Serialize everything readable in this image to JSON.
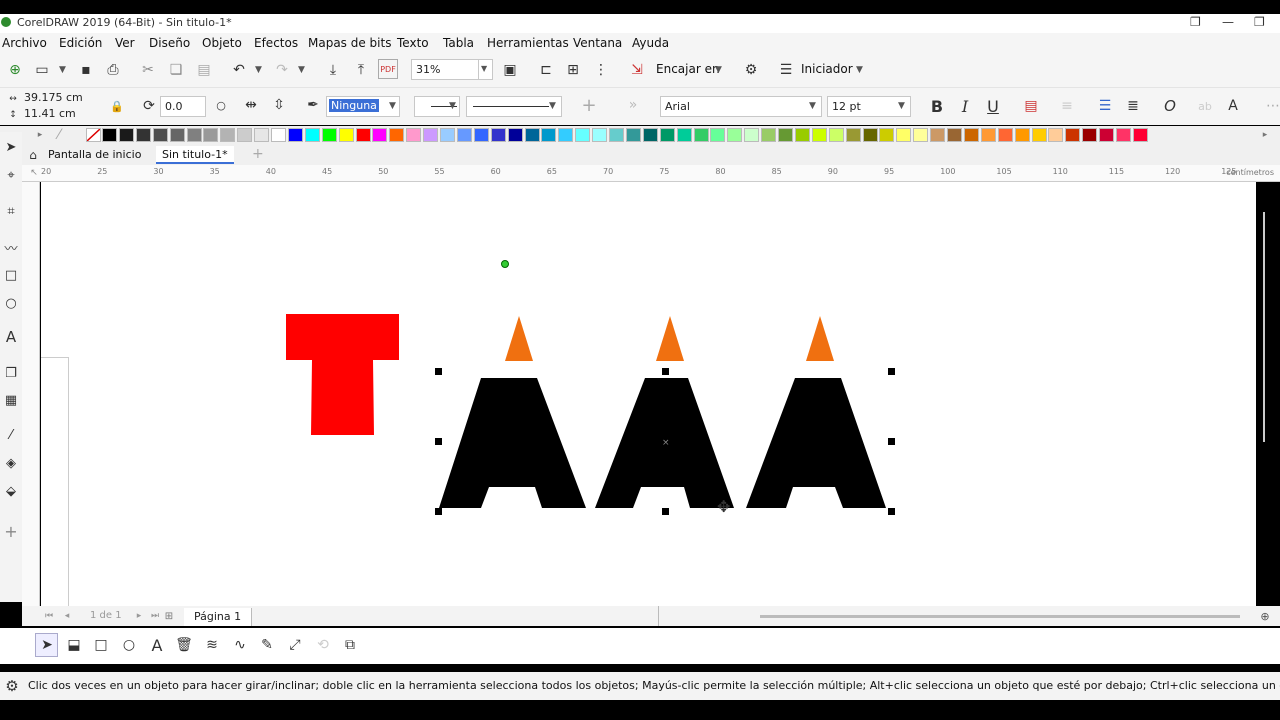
{
  "window": {
    "title": "CorelDRAW 2019 (64-Bit) - Sin titulo-1*",
    "restore_symbol": "❐",
    "minimize_symbol": "—"
  },
  "menu": [
    "Archivo",
    "Edición",
    "Ver",
    "Diseño",
    "Objeto",
    "Efectos",
    "Mapas de bits",
    "Texto",
    "Tabla",
    "Herramientas",
    "Ventana",
    "Ayuda"
  ],
  "toolbar": {
    "zoom": "31%",
    "snap_label": "Encajar en",
    "launcher_label": "Iniciador",
    "pdf_label": "PDF"
  },
  "property_bar": {
    "width": "39.175 cm",
    "height": "11.41 cm",
    "rotation": "0.0",
    "outline_fill": "Ninguna",
    "font_name": "Arial",
    "font_size": "12 pt",
    "bold": "B",
    "italic": "I",
    "underline": "U"
  },
  "palette_colors": [
    "#000000",
    "#1a1a1a",
    "#333333",
    "#4d4d4d",
    "#666666",
    "#808080",
    "#999999",
    "#b3b3b3",
    "#cccccc",
    "#e6e6e6",
    "#ffffff",
    "#0000ff",
    "#00ffff",
    "#00ff00",
    "#ffff00",
    "#ff0000",
    "#ff00ff",
    "#ff6600",
    "#ff99cc",
    "#cc99ff",
    "#99ccff",
    "#6699ff",
    "#3366ff",
    "#3333cc",
    "#000099",
    "#006699",
    "#0099cc",
    "#33ccff",
    "#66ffff",
    "#99ffff",
    "#66cccc",
    "#339999",
    "#006666",
    "#009966",
    "#00cc99",
    "#33cc66",
    "#66ff99",
    "#99ff99",
    "#ccffcc",
    "#99cc66",
    "#669933",
    "#99cc00",
    "#ccff00",
    "#ccff66",
    "#999933",
    "#666600",
    "#cccc00",
    "#ffff66",
    "#ffff99",
    "#cc9966",
    "#996633",
    "#cc6600",
    "#ff9933",
    "#ff6633",
    "#ff9900",
    "#ffcc00",
    "#ffcc99",
    "#cc3300",
    "#990000",
    "#cc0033",
    "#ff3366",
    "#ff0033"
  ],
  "tabs": {
    "home": "Pantalla de inicio",
    "doc": "Sin titulo-1*",
    "add": "+"
  },
  "ruler": {
    "unit": "centímetros",
    "ticks": [
      "20",
      "25",
      "30",
      "35",
      "40",
      "45",
      "50",
      "55",
      "60",
      "65",
      "70",
      "75",
      "80",
      "85",
      "90",
      "95",
      "100",
      "105",
      "110",
      "115",
      "120",
      "125"
    ]
  },
  "canvas_shapes": {
    "letter_t": "T",
    "letter_t_color": "#ff0000",
    "letter_a_color": "#000000",
    "triangle_color": "#f07010"
  },
  "pagebar": {
    "page_of": "1 de 1",
    "page_tab": "Página 1"
  },
  "status": {
    "message": "Clic dos veces en un objeto para hacer girar/inclinar; doble clic en la herramienta selecciona todos los objetos; Mayús-clic permite la selección múltiple; Alt+clic selecciona un objeto que esté por debajo; Ctrl+clic selecciona un objeto de un grupo"
  },
  "icons": {
    "new": "⊕",
    "open": "▭",
    "save": "▪",
    "print": "⎙",
    "undo": "↶",
    "redo": "↷",
    "import": "⤓",
    "export": "⤒",
    "fullscreen": "▣",
    "gear": "⚙",
    "list": "☰",
    "pick": "➤",
    "lock": "🔒",
    "plus": "+",
    "chevron_right": "»",
    "add": "+"
  }
}
